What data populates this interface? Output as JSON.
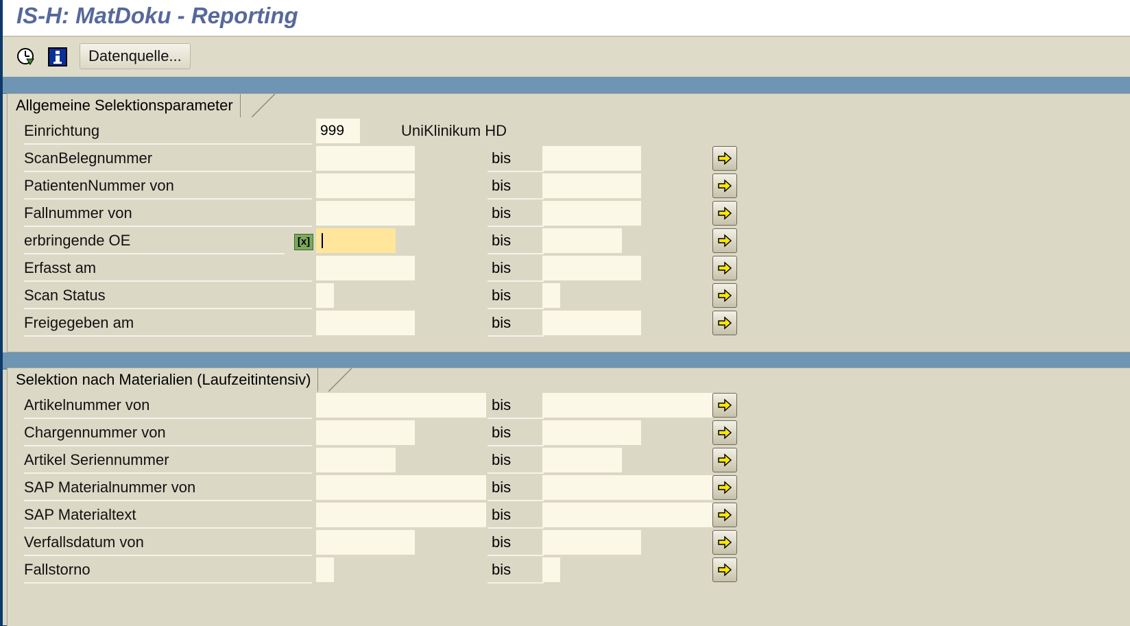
{
  "window": {
    "title": "IS-H: MatDoku - Reporting"
  },
  "toolbar": {
    "execute_icon": "clock-execute-icon",
    "info_icon": "info-icon",
    "datasource_label": "Datenquelle..."
  },
  "section1": {
    "title": "Allgemeine Selektionsparameter",
    "einrichtung": {
      "label": "Einrichtung",
      "value": "999",
      "text": "UniKlinikum HD"
    },
    "bis_label": "bis",
    "rows": [
      {
        "label": "ScanBelegnummer"
      },
      {
        "label": "PatientenNummer von"
      },
      {
        "label": "Fallnummer von"
      },
      {
        "label": "erbringende OE",
        "multi_icon": "[x]"
      },
      {
        "label": "Erfasst am"
      },
      {
        "label": "Scan Status"
      },
      {
        "label": "Freigegeben am"
      }
    ]
  },
  "section2": {
    "title": "Selektion nach Materialien (Laufzeitintensiv)",
    "bis_label": "bis",
    "rows": [
      {
        "label": "Artikelnummer von"
      },
      {
        "label": "Chargennummer von"
      },
      {
        "label": "Artikel Seriennummer"
      },
      {
        "label": "SAP Materialnummer von"
      },
      {
        "label": "SAP Materialtext"
      },
      {
        "label": "Verfallsdatum von"
      },
      {
        "label": "Fallstorno"
      }
    ]
  },
  "colors": {
    "accent": "#56689c",
    "active_field": "#ffe69b",
    "frame": "#0d3a68"
  }
}
